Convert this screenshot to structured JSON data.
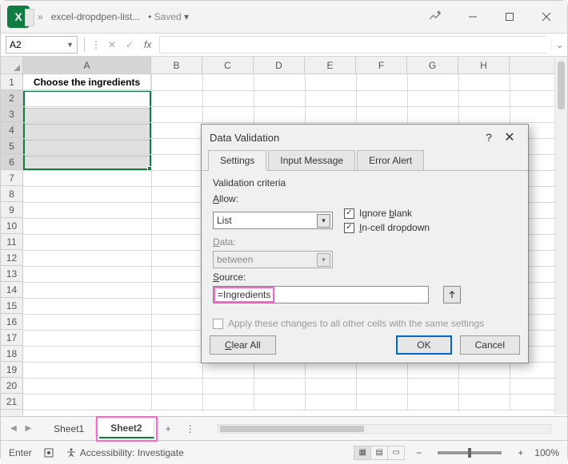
{
  "titlebar": {
    "filename": "excel-dropdpen-list...",
    "saved_label": "Saved"
  },
  "fxbar": {
    "namebox": "A2",
    "fx_label": "fx",
    "formula": ""
  },
  "columns": [
    "A",
    "B",
    "C",
    "D",
    "E",
    "F",
    "G",
    "H"
  ],
  "rows": [
    "1",
    "2",
    "3",
    "4",
    "5",
    "6",
    "7",
    "8",
    "9",
    "10",
    "11",
    "12",
    "13",
    "14",
    "15",
    "16",
    "17",
    "18",
    "19",
    "20",
    "21"
  ],
  "cells": {
    "A1": "Choose the ingredients"
  },
  "sheets": {
    "tab1": "Sheet1",
    "tab2": "Sheet2",
    "add": "+",
    "menu": "⋮"
  },
  "statusbar": {
    "mode": "Enter",
    "accessibility": "Accessibility: Investigate",
    "zoom": "100%"
  },
  "dialog": {
    "title": "Data Validation",
    "tabs": {
      "settings": "Settings",
      "input_msg": "Input Message",
      "error_alert": "Error Alert"
    },
    "legend": "Validation criteria",
    "allow_label": "Allow:",
    "allow_value": "List",
    "data_label": "Data:",
    "data_value": "between",
    "ignore_blank": "Ignore blank",
    "incell_dd": "In-cell dropdown",
    "source_label": "Source:",
    "source_value": "=Ingredients",
    "apply_all": "Apply these changes to all other cells with the same settings",
    "clear_all": "Clear All",
    "ok": "OK",
    "cancel": "Cancel"
  }
}
